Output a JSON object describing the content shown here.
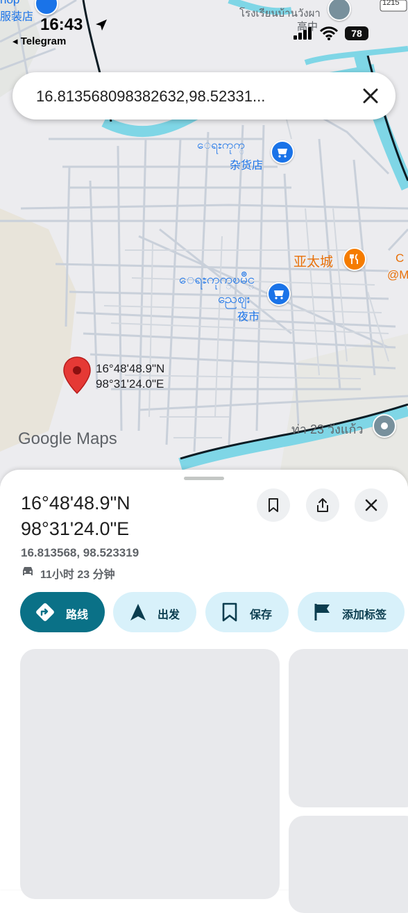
{
  "status_bar": {
    "time": "16:43",
    "back_app": "◂ Telegram",
    "battery": "78"
  },
  "search": {
    "value": "16.813568098382632,98.52331..."
  },
  "map_labels": {
    "top_left_shop_partial": "hop",
    "top_left_store_partial": "服装店",
    "thai_school": "โรงเรียนบ้านวังผา",
    "thai_school_cn": "高中",
    "road_number": "1215",
    "grocery_burmese": "ေရႊကုက္",
    "grocery_cn": "杂货店",
    "restaurant_cn": "亚太城",
    "edge_partial_1": "C",
    "edge_partial_2": "@M",
    "market_burmese_1": "ေရႊကုက္ၿမိဳင္",
    "market_burmese_2": "ညေဈး",
    "market_cn": "夜市",
    "pin_lat": "16°48'48.9\"N",
    "pin_lng": "98°31'24.0\"E",
    "thai_pier": "ท่า 23 วังแก้ว",
    "watermark": "Google Maps"
  },
  "place": {
    "title_line1": "16°48'48.9\"N",
    "title_line2": "98°31'24.0\"E",
    "decimal_coords": "16.813568, 98.523319",
    "drive_time": "11小时 23 分钟"
  },
  "actions": [
    {
      "label": "路线",
      "icon": "directions-icon"
    },
    {
      "label": "出发",
      "icon": "navigation-arrow-icon"
    },
    {
      "label": "保存",
      "icon": "bookmark-icon"
    },
    {
      "label": "添加标签",
      "icon": "flag-icon"
    }
  ],
  "colors": {
    "primary": "#0a7187",
    "chip": "#d8f1fa",
    "river": "#7fd6e6",
    "pin": "#e53935",
    "poi_shop": "#1a73e8",
    "poi_food": "#f57c00"
  }
}
